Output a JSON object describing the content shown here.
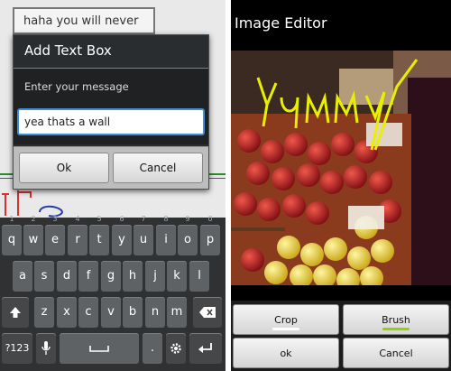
{
  "left": {
    "background_text": "haha you will never",
    "dialog": {
      "title": "Add Text Box",
      "message": "Enter your message",
      "input_value": "yea thats a wall",
      "ok_label": "Ok",
      "cancel_label": "Cancel"
    },
    "keyboard": {
      "row1": [
        "q",
        "w",
        "e",
        "r",
        "t",
        "y",
        "u",
        "i",
        "o",
        "p"
      ],
      "row1_hints": [
        "1",
        "2",
        "3",
        "4",
        "5",
        "6",
        "7",
        "8",
        "9",
        "0"
      ],
      "row2": [
        "a",
        "s",
        "d",
        "f",
        "g",
        "h",
        "j",
        "k",
        "l"
      ],
      "row3": [
        "z",
        "x",
        "c",
        "v",
        "b",
        "n",
        "m"
      ],
      "symbols_label": "?123",
      "period_label": "."
    }
  },
  "right": {
    "title": "Image Editor",
    "photo_text": "Yummy",
    "crop_label": "Crop",
    "brush_label": "Brush",
    "ok_label": "ok",
    "cancel_label": "Cancel",
    "colors": {
      "crop_indicator": "#ffffff",
      "brush_indicator": "#8fd400",
      "drawing": "#e8f000"
    }
  }
}
